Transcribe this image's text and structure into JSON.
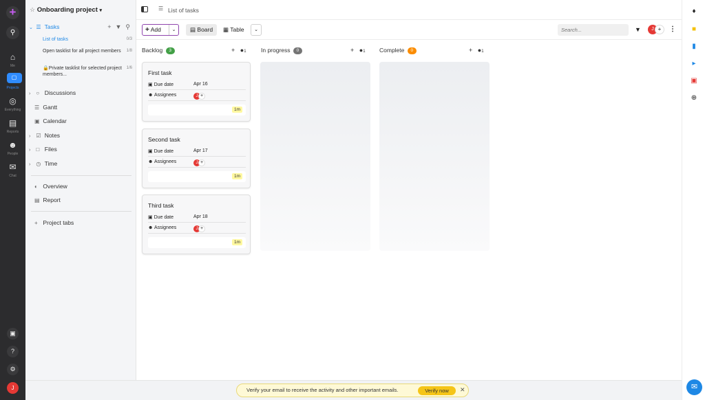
{
  "rail": {
    "items": [
      {
        "label": "Me",
        "icon": "home-icon"
      },
      {
        "label": "Projects",
        "icon": "folder-icon"
      },
      {
        "label": "Everything",
        "icon": "globe-icon"
      },
      {
        "label": "Reports",
        "icon": "bar-chart-icon"
      },
      {
        "label": "People",
        "icon": "people-icon"
      },
      {
        "label": "Chat",
        "icon": "chat-icon"
      }
    ],
    "avatar": "J"
  },
  "sidebar": {
    "project_title": "Onboarding project",
    "tasks_label": "Tasks",
    "tasklists": [
      {
        "name": "List of tasks",
        "count": "0/3"
      },
      {
        "name": "Open tasklist for all project members",
        "count": "1/8"
      },
      {
        "name": "Private tasklist for selected project members...",
        "count": "1/6"
      }
    ],
    "items": [
      "Discussions",
      "Gantt",
      "Calendar",
      "Notes",
      "Files",
      "Time"
    ],
    "overview": "Overview",
    "report": "Report",
    "project_tabs": "Project tabs"
  },
  "header": {
    "breadcrumb": "List of tasks"
  },
  "toolbar": {
    "add_label": "Add",
    "board_label": "Board",
    "table_label": "Table",
    "search_placeholder": "Search...",
    "avatar": "J"
  },
  "board": {
    "columns": [
      {
        "name": "Backlog",
        "count": "3",
        "color": "#43a047"
      },
      {
        "name": "In progress",
        "count": "0",
        "color": "#757575"
      },
      {
        "name": "Complete",
        "count": "0",
        "color": "#fb8c00"
      }
    ],
    "member_count": "1",
    "due_label": "Due date",
    "assignees_label": "Assignees",
    "cards": [
      {
        "title": "First task",
        "due": "Apr 16",
        "assignee": "J",
        "estimate": "1m"
      },
      {
        "title": "Second task",
        "due": "Apr 17",
        "assignee": "J",
        "estimate": "1m"
      },
      {
        "title": "Third task",
        "due": "Apr 18",
        "assignee": "J",
        "estimate": "1m"
      }
    ]
  },
  "banner": {
    "text": "Verify your email to receive the activity and other important emails.",
    "button": "Verify now"
  }
}
